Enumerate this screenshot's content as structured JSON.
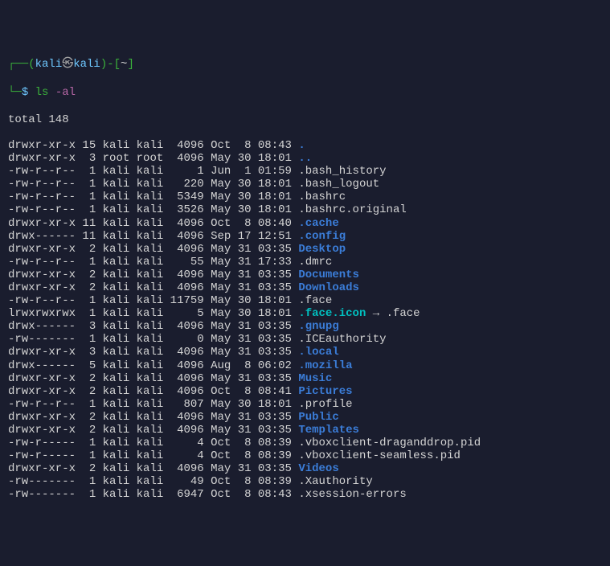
{
  "prompt": {
    "open_paren": "┌──(",
    "user": "kali",
    "at": "㉿",
    "host": "kali",
    "close_paren": ")-[",
    "cwd": "~",
    "end_bracket": "]",
    "line2_prefix": "└─",
    "dollar": "$",
    "command": "ls",
    "option": "-al"
  },
  "total_line": "total 148",
  "rows": [
    {
      "perms": "drwxr-xr-x",
      "links": "15",
      "owner": "kali",
      "group": "kali",
      "size": "4096",
      "date": "Oct  8 08:43",
      "name": ".",
      "type": "dir"
    },
    {
      "perms": "drwxr-xr-x",
      "links": "3",
      "owner": "root",
      "group": "root",
      "size": "4096",
      "date": "May 30 18:01",
      "name": "..",
      "type": "dir"
    },
    {
      "perms": "-rw-r--r--",
      "links": "1",
      "owner": "kali",
      "group": "kali",
      "size": "1",
      "date": "Jun  1 01:59",
      "name": ".bash_history",
      "type": "file"
    },
    {
      "perms": "-rw-r--r--",
      "links": "1",
      "owner": "kali",
      "group": "kali",
      "size": "220",
      "date": "May 30 18:01",
      "name": ".bash_logout",
      "type": "file"
    },
    {
      "perms": "-rw-r--r--",
      "links": "1",
      "owner": "kali",
      "group": "kali",
      "size": "5349",
      "date": "May 30 18:01",
      "name": ".bashrc",
      "type": "file"
    },
    {
      "perms": "-rw-r--r--",
      "links": "1",
      "owner": "kali",
      "group": "kali",
      "size": "3526",
      "date": "May 30 18:01",
      "name": ".bashrc.original",
      "type": "file"
    },
    {
      "perms": "drwxr-xr-x",
      "links": "11",
      "owner": "kali",
      "group": "kali",
      "size": "4096",
      "date": "Oct  8 08:40",
      "name": ".cache",
      "type": "dir"
    },
    {
      "perms": "drwx------",
      "links": "11",
      "owner": "kali",
      "group": "kali",
      "size": "4096",
      "date": "Sep 17 12:51",
      "name": ".config",
      "type": "dir"
    },
    {
      "perms": "drwxr-xr-x",
      "links": "2",
      "owner": "kali",
      "group": "kali",
      "size": "4096",
      "date": "May 31 03:35",
      "name": "Desktop",
      "type": "dir"
    },
    {
      "perms": "-rw-r--r--",
      "links": "1",
      "owner": "kali",
      "group": "kali",
      "size": "55",
      "date": "May 31 17:33",
      "name": ".dmrc",
      "type": "file"
    },
    {
      "perms": "drwxr-xr-x",
      "links": "2",
      "owner": "kali",
      "group": "kali",
      "size": "4096",
      "date": "May 31 03:35",
      "name": "Documents",
      "type": "dir"
    },
    {
      "perms": "drwxr-xr-x",
      "links": "2",
      "owner": "kali",
      "group": "kali",
      "size": "4096",
      "date": "May 31 03:35",
      "name": "Downloads",
      "type": "dir"
    },
    {
      "perms": "-rw-r--r--",
      "links": "1",
      "owner": "kali",
      "group": "kali",
      "size": "11759",
      "date": "May 30 18:01",
      "name": ".face",
      "type": "file"
    },
    {
      "perms": "lrwxrwxrwx",
      "links": "1",
      "owner": "kali",
      "group": "kali",
      "size": "5",
      "date": "May 30 18:01",
      "name": ".face.icon",
      "type": "link",
      "target": ".face"
    },
    {
      "perms": "drwx------",
      "links": "3",
      "owner": "kali",
      "group": "kali",
      "size": "4096",
      "date": "May 31 03:35",
      "name": ".gnupg",
      "type": "dir"
    },
    {
      "perms": "-rw-------",
      "links": "1",
      "owner": "kali",
      "group": "kali",
      "size": "0",
      "date": "May 31 03:35",
      "name": ".ICEauthority",
      "type": "file"
    },
    {
      "perms": "drwxr-xr-x",
      "links": "3",
      "owner": "kali",
      "group": "kali",
      "size": "4096",
      "date": "May 31 03:35",
      "name": ".local",
      "type": "dir"
    },
    {
      "perms": "drwx------",
      "links": "5",
      "owner": "kali",
      "group": "kali",
      "size": "4096",
      "date": "Aug  8 06:02",
      "name": ".mozilla",
      "type": "dir"
    },
    {
      "perms": "drwxr-xr-x",
      "links": "2",
      "owner": "kali",
      "group": "kali",
      "size": "4096",
      "date": "May 31 03:35",
      "name": "Music",
      "type": "dir"
    },
    {
      "perms": "drwxr-xr-x",
      "links": "2",
      "owner": "kali",
      "group": "kali",
      "size": "4096",
      "date": "Oct  8 08:41",
      "name": "Pictures",
      "type": "dir"
    },
    {
      "perms": "-rw-r--r--",
      "links": "1",
      "owner": "kali",
      "group": "kali",
      "size": "807",
      "date": "May 30 18:01",
      "name": ".profile",
      "type": "file"
    },
    {
      "perms": "drwxr-xr-x",
      "links": "2",
      "owner": "kali",
      "group": "kali",
      "size": "4096",
      "date": "May 31 03:35",
      "name": "Public",
      "type": "dir"
    },
    {
      "perms": "drwxr-xr-x",
      "links": "2",
      "owner": "kali",
      "group": "kali",
      "size": "4096",
      "date": "May 31 03:35",
      "name": "Templates",
      "type": "dir"
    },
    {
      "perms": "-rw-r-----",
      "links": "1",
      "owner": "kali",
      "group": "kali",
      "size": "4",
      "date": "Oct  8 08:39",
      "name": ".vboxclient-draganddrop.pid",
      "type": "file"
    },
    {
      "perms": "-rw-r-----",
      "links": "1",
      "owner": "kali",
      "group": "kali",
      "size": "4",
      "date": "Oct  8 08:39",
      "name": ".vboxclient-seamless.pid",
      "type": "file"
    },
    {
      "perms": "drwxr-xr-x",
      "links": "2",
      "owner": "kali",
      "group": "kali",
      "size": "4096",
      "date": "May 31 03:35",
      "name": "Videos",
      "type": "dir"
    },
    {
      "perms": "-rw-------",
      "links": "1",
      "owner": "kali",
      "group": "kali",
      "size": "49",
      "date": "Oct  8 08:39",
      "name": ".Xauthority",
      "type": "file"
    },
    {
      "perms": "-rw-------",
      "links": "1",
      "owner": "kali",
      "group": "kali",
      "size": "6947",
      "date": "Oct  8 08:43",
      "name": ".xsession-errors",
      "type": "file"
    }
  ]
}
